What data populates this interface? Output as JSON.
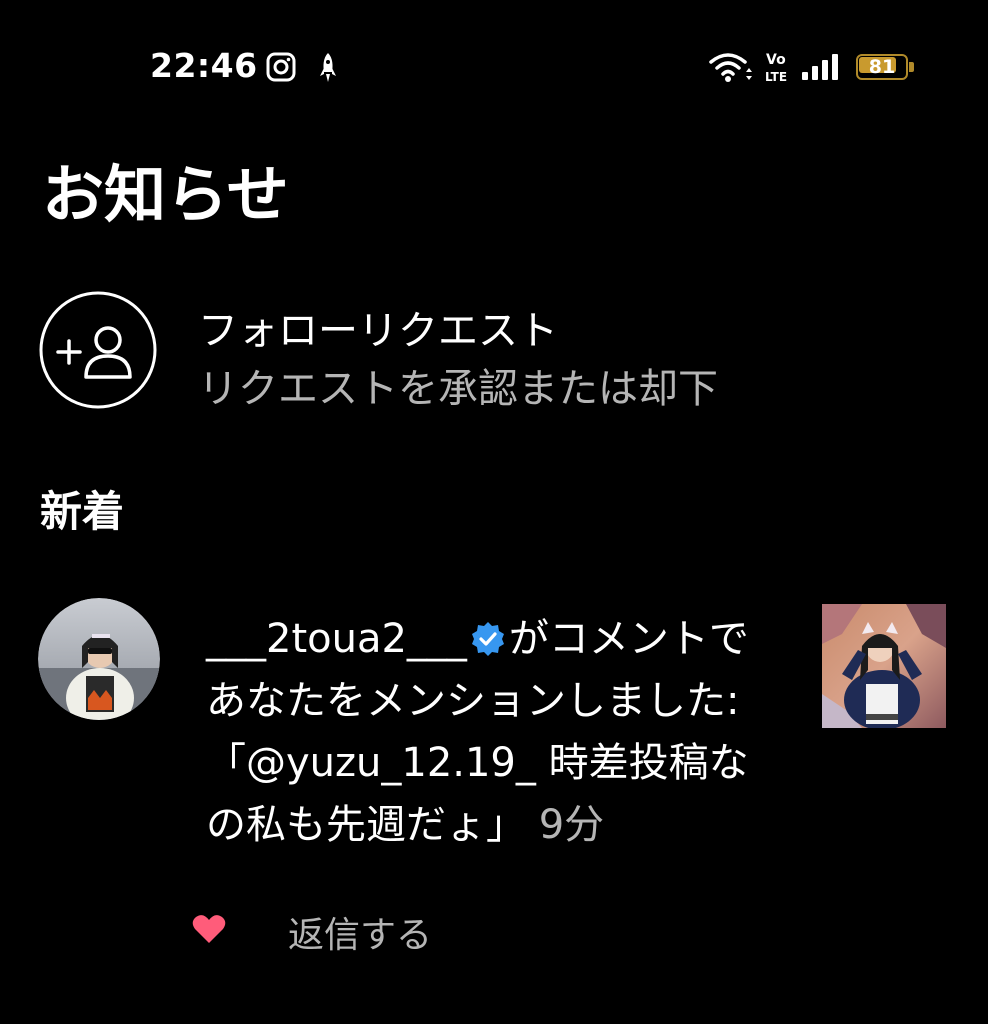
{
  "status_bar": {
    "time": "22:46",
    "battery_level": "81",
    "battery_fraction": 0.81,
    "icons": [
      "instagram-icon",
      "rocket-icon",
      "wifi-icon",
      "volte-icon",
      "signal-icon",
      "battery-icon"
    ]
  },
  "page": {
    "title": "お知らせ"
  },
  "follow_request": {
    "title": "フォローリクエスト",
    "subtitle": "リクエストを承認または却下",
    "icon": "add-person-icon"
  },
  "section": {
    "heading": "新着"
  },
  "notification": {
    "username": "___2toua2___",
    "verified": true,
    "action": "がコメントであなたをメンションしました: 「@yuzu_12.19_ 時差投稿なの私も先週だょ」",
    "time_ago": "9分",
    "reply_label": "返信する",
    "like_icon": "heart-icon"
  },
  "colors": {
    "background": "#000000",
    "text_primary": "#ffffff",
    "text_secondary": "#b5b5b5",
    "verified_blue": "#3797f0",
    "like_red": "#ff5c7a",
    "battery": "#c99a2e"
  }
}
